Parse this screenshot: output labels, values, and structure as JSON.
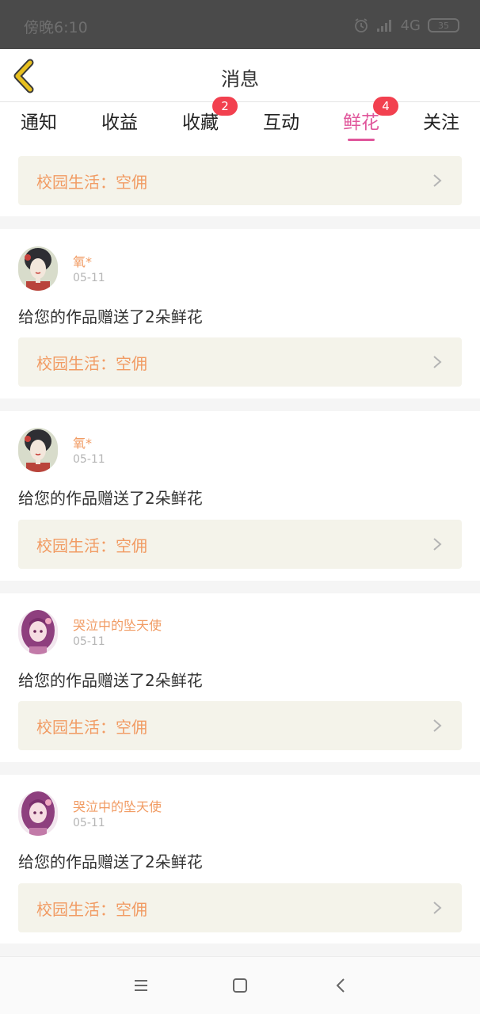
{
  "status_bar": {
    "time": "傍晚6:10",
    "network": "4G",
    "battery": "35"
  },
  "header": {
    "title": "消息"
  },
  "tabs": [
    {
      "label": "通知",
      "badge": ""
    },
    {
      "label": "收益",
      "badge": ""
    },
    {
      "label": "收藏",
      "badge": "2"
    },
    {
      "label": "互动",
      "badge": ""
    },
    {
      "label": "鲜花",
      "badge": "4",
      "active": true
    },
    {
      "label": "关注",
      "badge": ""
    }
  ],
  "top_card": {
    "link_text": "校园生活：空佣"
  },
  "messages": [
    {
      "username": "氧*",
      "date": "05-11",
      "text": "给您的作品赠送了2朵鲜花",
      "link_text": "校园生活：空佣",
      "avatar": "geisha-avatar"
    },
    {
      "username": "氧*",
      "date": "05-11",
      "text": "给您的作品赠送了2朵鲜花",
      "link_text": "校园生活：空佣",
      "avatar": "geisha-avatar"
    },
    {
      "username": "哭泣中的坠天使",
      "date": "05-11",
      "text": "给您的作品赠送了2朵鲜花",
      "link_text": "校园生活：空佣",
      "avatar": "anime-girl-avatar"
    },
    {
      "username": "哭泣中的坠天使",
      "date": "05-11",
      "text": "给您的作品赠送了2朵鲜花",
      "link_text": "校园生活：空佣",
      "avatar": "anime-girl-avatar"
    }
  ],
  "colors": {
    "accent": "#e0569b",
    "badge": "#f2404f",
    "link": "#f19b63",
    "card_bg": "#f4f3ea",
    "back_arrow": "#e8c01f"
  },
  "nav": {
    "icons": [
      "menu-icon",
      "home-icon",
      "back-icon"
    ]
  }
}
